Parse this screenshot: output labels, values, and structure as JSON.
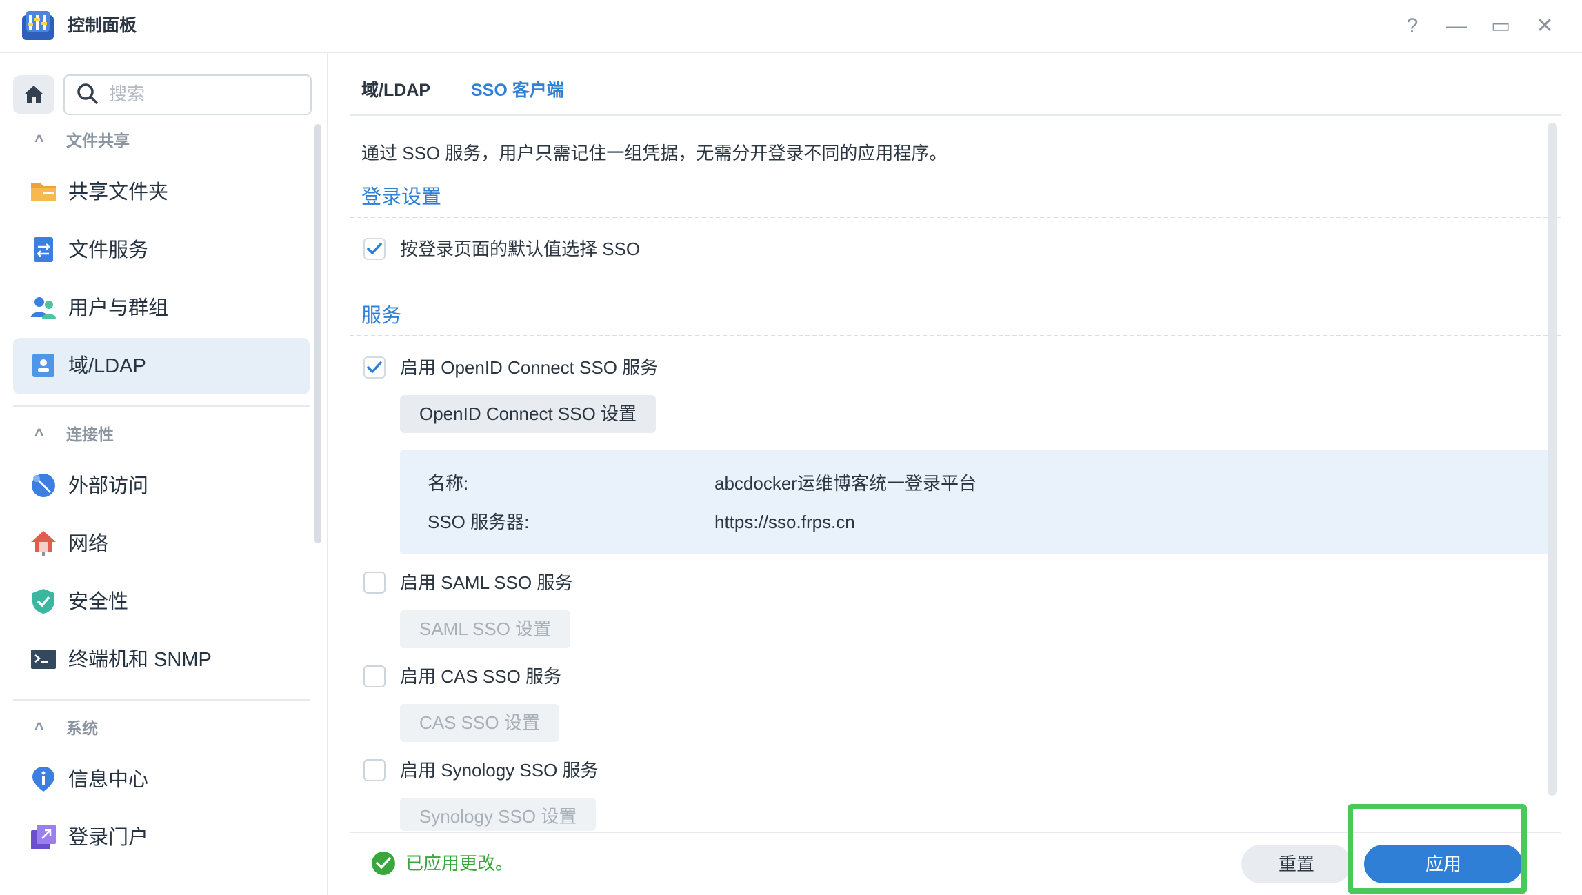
{
  "window": {
    "title": "控制面板",
    "controls": {
      "help": "?",
      "minimize": "—",
      "maximize": "▭",
      "close": "✕"
    }
  },
  "sidebar": {
    "search_placeholder": "搜索",
    "sections": [
      {
        "label": "文件共享",
        "items": [
          "共享文件夹",
          "文件服务",
          "用户与群组",
          "域/LDAP"
        ]
      },
      {
        "label": "连接性",
        "items": [
          "外部访问",
          "网络",
          "安全性",
          "终端机和 SNMP"
        ]
      },
      {
        "label": "系统",
        "items": [
          "信息中心",
          "登录门户"
        ]
      }
    ],
    "active_item": "域/LDAP"
  },
  "tabs": [
    {
      "label": "域/LDAP",
      "active": false
    },
    {
      "label": "SSO 客户端",
      "active": true
    }
  ],
  "main": {
    "description": "通过 SSO 服务，用户只需记住一组凭据，无需分开登录不同的应用程序。",
    "login_settings": {
      "title": "登录设置",
      "default_sso_label": "按登录页面的默认值选择 SSO",
      "default_sso_checked": true
    },
    "services": {
      "title": "服务",
      "openid": {
        "label": "启用 OpenID Connect SSO 服务",
        "checked": true,
        "button": "OpenID Connect SSO 设置",
        "info": {
          "name_key": "名称:",
          "name_value": "abcdocker运维博客统一登录平台",
          "server_key": "SSO 服务器:",
          "server_value": "https://sso.frps.cn"
        }
      },
      "saml": {
        "label": "启用 SAML SSO 服务",
        "checked": false,
        "button": "SAML SSO 设置"
      },
      "cas": {
        "label": "启用 CAS SSO 服务",
        "checked": false,
        "button": "CAS SSO 设置"
      },
      "synology": {
        "label": "启用 Synology SSO 服务",
        "checked": false,
        "button": "Synology SSO 设置"
      }
    }
  },
  "footer": {
    "status": "已应用更改。",
    "reset_label": "重置",
    "apply_label": "应用"
  },
  "colors": {
    "accent": "#2f7fd7",
    "success": "#3aa63e",
    "highlight": "#48c95a"
  }
}
